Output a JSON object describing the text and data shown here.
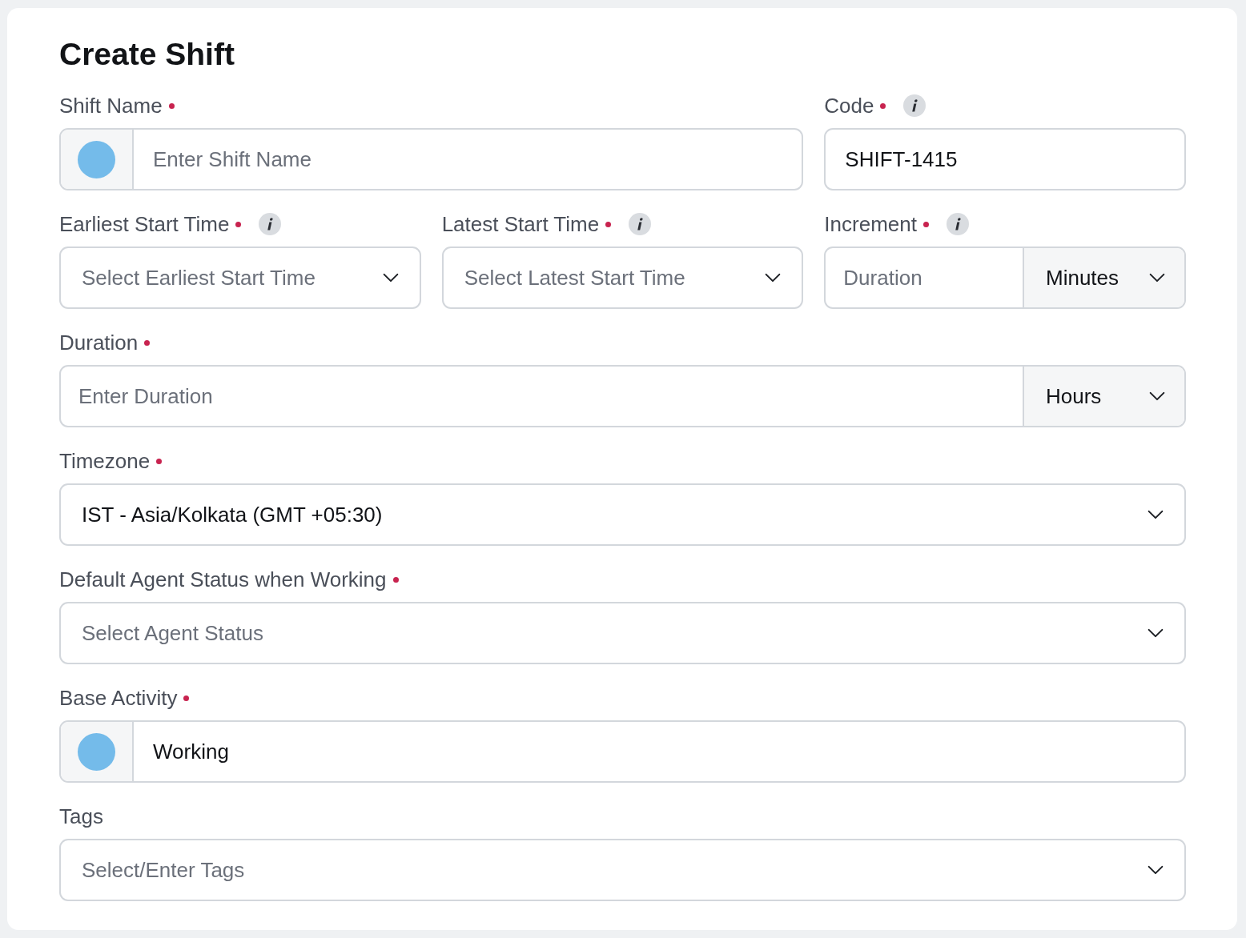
{
  "title": "Create Shift",
  "rows": [
    [
      {
        "kind": "color-text",
        "label": "Shift Name",
        "required": true,
        "color": "#74bbea",
        "placeholder": "Enter Shift Name"
      },
      {
        "kind": "text",
        "label": "Code",
        "required": true,
        "info": true,
        "value": "SHIFT-1415"
      }
    ],
    [
      {
        "kind": "select",
        "label": "Earliest Start Time",
        "required": true,
        "info": true,
        "placeholder": "Select Earliest Start Time"
      },
      {
        "kind": "select",
        "label": "Latest Start Time",
        "required": true,
        "info": true,
        "placeholder": "Select Latest Start Time"
      },
      {
        "kind": "number-unit",
        "label": "Increment",
        "required": true,
        "info": true,
        "placeholder": "Duration",
        "unit": "Minutes"
      }
    ],
    [
      {
        "kind": "number-unit",
        "label": "Duration",
        "required": true,
        "placeholder": "Enter Duration",
        "unit": "Hours"
      }
    ],
    [
      {
        "kind": "select",
        "label": "Timezone",
        "required": true,
        "value": "IST - Asia/Kolkata (GMT +05:30)"
      }
    ],
    [
      {
        "kind": "select",
        "label": "Default Agent Status when Working",
        "required": true,
        "placeholder": "Select Agent Status"
      }
    ],
    [
      {
        "kind": "color-text",
        "label": "Base Activity",
        "required": true,
        "color": "#74bbea",
        "value": "Working"
      }
    ],
    [
      {
        "kind": "select",
        "label": "Tags",
        "placeholder": "Select/Enter Tags"
      }
    ]
  ]
}
